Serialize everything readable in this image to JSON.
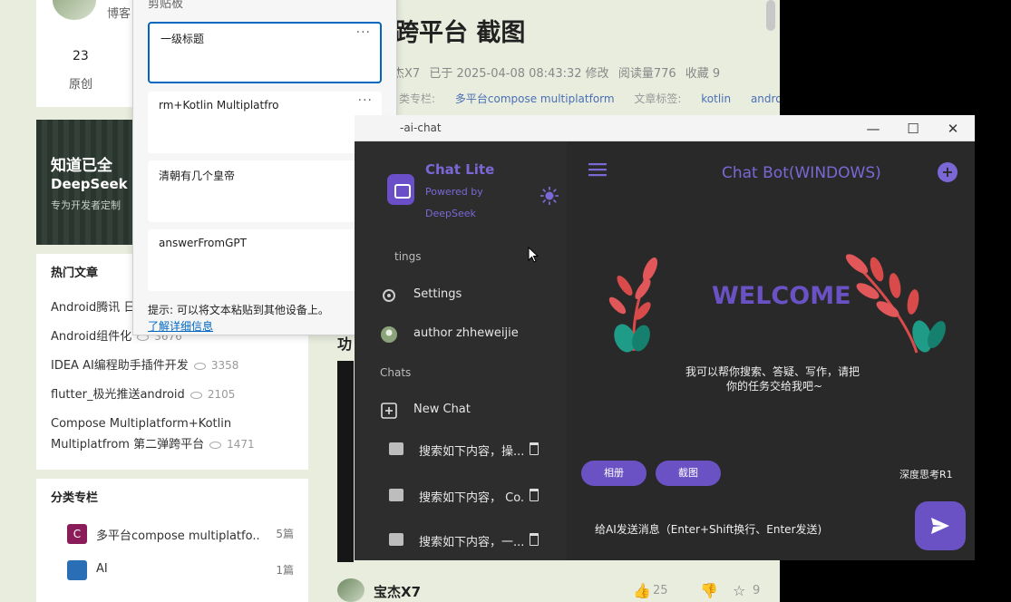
{
  "blog": {
    "profile_name": "博客",
    "original_count": "23",
    "original_label": "原创",
    "ad": {
      "line1": "知道已全",
      "line2": "DeepSeek",
      "line3": "专为开发者定制"
    },
    "article_title": "跨平台 截图",
    "meta": {
      "author": "杰X7",
      "modified": "已于 2025-04-08 08:43:32 修改",
      "views": "阅读量776",
      "favorites": "收藏 9"
    },
    "tags_label": "类专栏:",
    "tags": [
      "多平台compose multiplatform",
      "kotlin",
      "andro"
    ],
    "tags_label2": "文章标签:",
    "hot": {
      "title": "热门文章",
      "items": [
        {
          "title": "Android腾讯 日",
          "views": ""
        },
        {
          "title": "Android组件化",
          "views": "3676"
        },
        {
          "title": "IDEA AI编程助手插件开发",
          "views": "3358"
        },
        {
          "title": "flutter_极光推送android",
          "views": "2105"
        },
        {
          "title": "Compose Multiplatform+Kotlin",
          "views": ""
        },
        {
          "title": "Multiplatfrom 第二弹跨平台",
          "views": "1471"
        }
      ]
    },
    "categories": {
      "title": "分类专栏",
      "items": [
        {
          "label": "多平台compose multiplatfo...",
          "count": "5篇",
          "icon": "C",
          "color": "#8a1c5a"
        },
        {
          "label": "AI",
          "count": "1篇",
          "icon": "",
          "color": "#2a6fb5"
        }
      ]
    },
    "section_stub": "功",
    "footer": {
      "author": "宝杰X7",
      "likes": "25",
      "stars": "9"
    }
  },
  "clipboard": {
    "title": "剪贴板",
    "items": [
      {
        "text": "一级标题",
        "selected": true
      },
      {
        "text": "rm+Kotlin Multiplatfro",
        "selected": false
      },
      {
        "text": "清朝有几个皇帝",
        "selected": false
      },
      {
        "text": "answerFromGPT",
        "selected": false
      }
    ],
    "more": "···",
    "tip": "提示: 可以将文本粘贴到其他设备上。",
    "link": "了解详细信息"
  },
  "chat_app": {
    "window_title": "-ai-chat",
    "window_controls": {
      "minimize": "—",
      "maximize": "☐",
      "close": "✕"
    },
    "app_name": "Chat Lite",
    "powered_line1": "Powered by",
    "powered_line2": "DeepSeek",
    "settings_header": "tings",
    "settings_label": "Settings",
    "author_label": "author zhheweijie",
    "chats_header": "Chats",
    "new_chat_label": "New Chat",
    "chats": [
      "搜索如下内容，操...",
      "搜索如下内容， Co...",
      "搜索如下内容，一..."
    ],
    "header_title": "Chat Bot(WINDOWS)",
    "welcome": "WELCOME",
    "welcome_desc1": "我可以帮你搜索、答疑、写作，请把",
    "welcome_desc2": "你的任务交给我吧~",
    "album_button": "相册",
    "screenshot_button": "截图",
    "deep_think": "深度思考R1",
    "input_placeholder": "给AI发送消息（Enter+Shift换行、Enter发送)",
    "accent_color": "#6a52c4"
  }
}
